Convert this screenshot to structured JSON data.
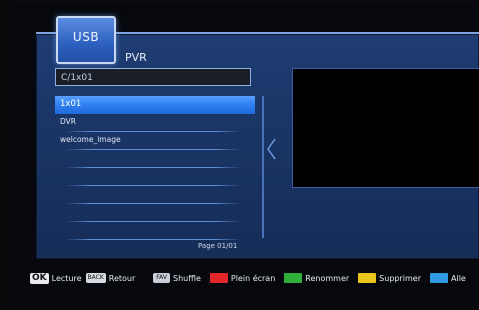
{
  "tab": {
    "label": "USB"
  },
  "title": "PVR",
  "path": "C/1x01",
  "files": [
    {
      "name": "1x01",
      "selected": true
    },
    {
      "name": "DVR",
      "selected": false
    },
    {
      "name": "welcome_image",
      "selected": false
    },
    {
      "name": "",
      "selected": false
    },
    {
      "name": "",
      "selected": false
    },
    {
      "name": "",
      "selected": false
    },
    {
      "name": "",
      "selected": false
    },
    {
      "name": "",
      "selected": false
    }
  ],
  "page_info": "Page  01/01",
  "footer": {
    "ok_key": "OK",
    "ok_label": "Lecture",
    "back_key": "BACK",
    "back_label": "Retour",
    "fav_key": "FAV",
    "fav_label": "Shuffle",
    "red_label": "Plein écran",
    "green_label": "Renommer",
    "yellow_label": "Supprimer",
    "blue_label": "Alle"
  },
  "colors": {
    "red": "#e3262a",
    "green": "#2fae3a",
    "yellow": "#e8c61c",
    "blue": "#2f9ae0",
    "selection": "#2f7ff0",
    "panel": "#1d3a6e"
  }
}
